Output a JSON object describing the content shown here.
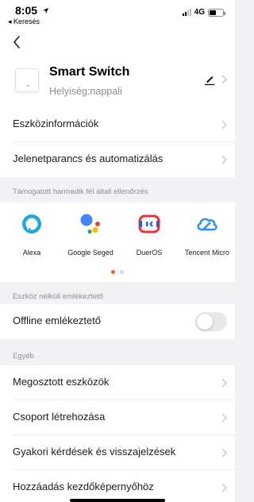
{
  "status_bar": {
    "time": "8:05",
    "back_app": "◂ Keresés",
    "network": "4G"
  },
  "device": {
    "name": "Smart Switch",
    "location": "Helyiség:nappali"
  },
  "menu_top": [
    {
      "label": "Eszközinformációk"
    },
    {
      "label": "Jelenetparancs és automatizálás"
    }
  ],
  "third_party": {
    "section_title": "Támogatott harmadik fél általi ellenőrzés",
    "assistants": [
      {
        "name": "Alexa",
        "icon": "alexa-icon"
      },
      {
        "name": "Google Segéd",
        "icon": "google-assistant-icon"
      },
      {
        "name": "DuerOS",
        "icon": "dueros-icon"
      },
      {
        "name": "Tencent Micro",
        "icon": "tencent-cloud-icon"
      }
    ],
    "pager": {
      "pages": 2,
      "current": 1
    }
  },
  "offline": {
    "section_title": "Eszköz nélküli emlékeztető",
    "label": "Offline emlékeztető",
    "enabled": false
  },
  "other": {
    "section_title": "Egyéb",
    "items": [
      {
        "label": "Megosztott eszközök"
      },
      {
        "label": "Csoport létrehozása"
      },
      {
        "label": "Gyakori kérdések és visszajelzések"
      },
      {
        "label": "Hozzáadás kezdőképernyőhöz"
      }
    ]
  },
  "colors": {
    "accent": "#ff5a28",
    "background": "#f2f2f4",
    "secondary_text": "#8e8e93",
    "alexa": "#1fa8e0",
    "dueros": "#e8333c",
    "tencent": "#2a8fe6"
  }
}
